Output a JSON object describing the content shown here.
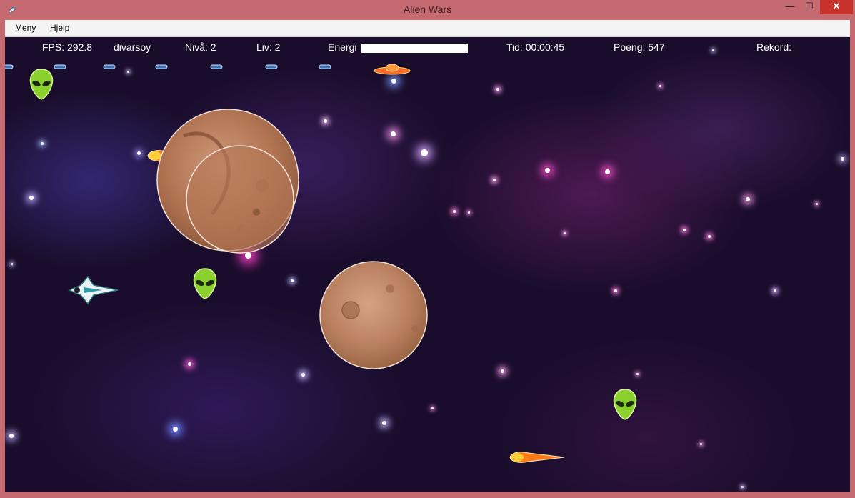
{
  "window": {
    "title": "Alien Wars",
    "minimize_symbol": "—",
    "maximize_symbol": "☐",
    "close_symbol": "✕"
  },
  "menu": {
    "items": [
      {
        "label": "Meny"
      },
      {
        "label": "Hjelp"
      }
    ]
  },
  "hud": {
    "fps": "FPS: 292.8",
    "player": "divarsoy",
    "level": "Nivå: 2",
    "lives": "Liv: 2",
    "energy_label": "Energi",
    "energy_fraction": 1.0,
    "time": "Tid: 00:00:45",
    "score": "Poeng: 547",
    "record": "Rekord:"
  },
  "icons": {
    "app": "rocket-icon",
    "player": "spaceship-icon",
    "enemy": "alien-head-icon",
    "projectile": "fireball-icon",
    "ufo": "ufo-icon",
    "shield": "shield-plate-icon",
    "asteroid": "asteroid-icon"
  },
  "colors": {
    "titlebar": "#c66a72",
    "close_button": "#c7332b",
    "space_background": "#1a0d2b",
    "alien_green": "#8bd12e",
    "asteroid_brown": "#b8785a",
    "fireball": "#ff8a1e"
  }
}
